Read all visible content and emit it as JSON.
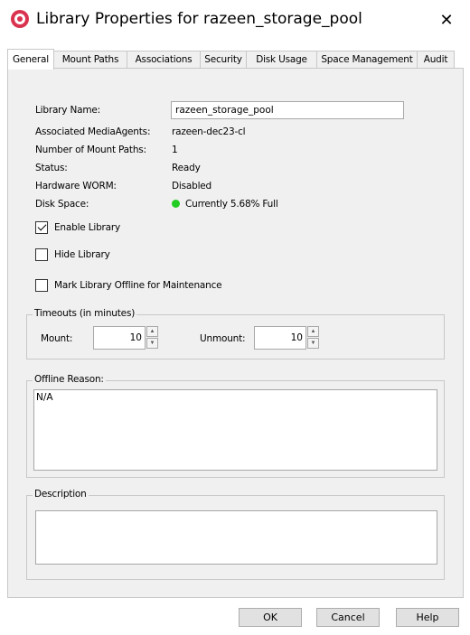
{
  "window": {
    "title": "Library Properties for razeen_storage_pool",
    "close_glyph": "✕"
  },
  "tabs": [
    {
      "label": "General",
      "active": true
    },
    {
      "label": "Mount Paths"
    },
    {
      "label": "Associations"
    },
    {
      "label": "Security"
    },
    {
      "label": "Disk Usage"
    },
    {
      "label": "Space Management"
    },
    {
      "label": "Audit"
    }
  ],
  "general": {
    "library_name_label": "Library Name:",
    "library_name_value": "razeen_storage_pool",
    "media_agents_label": "Associated MediaAgents:",
    "media_agents_value": "razeen-dec23-cl",
    "mount_paths_label": "Number of Mount Paths:",
    "mount_paths_value": "1",
    "status_label": "Status:",
    "status_value": "Ready",
    "worm_label": "Hardware WORM:",
    "worm_value": "Disabled",
    "disk_space_label": "Disk Space:",
    "disk_space_value": "Currently 5.68% Full",
    "disk_status_color": "#22cc22"
  },
  "options": {
    "enable_library": {
      "label": "Enable Library",
      "checked": true
    },
    "hide_library": {
      "label": "Hide Library",
      "checked": false
    },
    "offline_maintenance": {
      "label": "Mark Library Offline for Maintenance",
      "checked": false
    }
  },
  "timeouts": {
    "legend": "Timeouts (in minutes)",
    "mount_label": "Mount:",
    "mount_value": "10",
    "unmount_label": "Unmount:",
    "unmount_value": "10"
  },
  "offline_reason": {
    "legend": "Offline Reason:",
    "value": "N/A"
  },
  "description": {
    "legend": "Description",
    "value": ""
  },
  "buttons": {
    "ok": "OK",
    "cancel": "Cancel",
    "help": "Help"
  }
}
